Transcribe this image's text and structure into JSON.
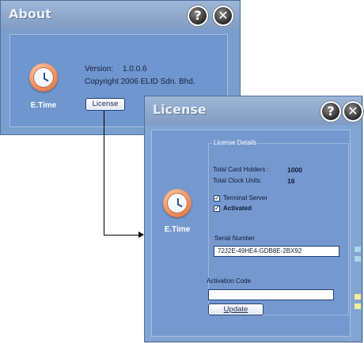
{
  "about": {
    "title": "About",
    "app_name": "E.Time",
    "version_label": "Version:",
    "version_value": "1.0.0.6",
    "copyright": "Copyright 2006 ELID Sdn. Bhd.",
    "license_button": "License",
    "help_glyph": "?",
    "close_glyph": "✕"
  },
  "license": {
    "title": "License",
    "app_name": "E.Time",
    "help_glyph": "?",
    "close_glyph": "✕",
    "details_legend": "License Details",
    "total_card_holders_label": "Total Card Holders :",
    "total_card_holders_value": "1000",
    "total_clock_units_label": "Total Clock Units:",
    "total_clock_units_value": "16",
    "terminal_server_label": "Terminal Server",
    "terminal_server_checked": true,
    "activated_label": "Activated",
    "activated_checked": true,
    "serial_label": "Serial Number",
    "serial_value": "72J2E-49HE4-GDB8E-2BX92",
    "activation_label": "Activation Code",
    "activation_value": "",
    "update_button": "Update"
  },
  "icons": [
    "help-icon",
    "close-icon",
    "clock-icon",
    "checkmark-icon",
    "arrow-icon"
  ],
  "colors": {
    "window_bg": "#82a5d4",
    "panel_bg": "#7599cf",
    "titlebar": "#8faad0",
    "title_text": "#e9f0f8"
  }
}
